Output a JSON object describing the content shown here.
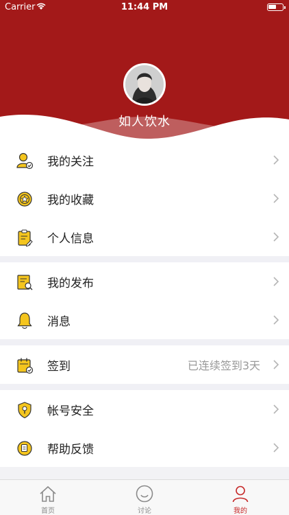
{
  "status_bar": {
    "carrier": "Carrier",
    "time": "11:44 PM"
  },
  "profile": {
    "username": "如人饮水"
  },
  "menu_groups": [
    {
      "items": [
        {
          "label": "我的关注",
          "icon": "follow-user-icon"
        },
        {
          "label": "我的收藏",
          "icon": "favorite-star-icon"
        },
        {
          "label": "个人信息",
          "icon": "profile-clipboard-icon"
        }
      ]
    },
    {
      "items": [
        {
          "label": "我的发布",
          "icon": "publish-doc-icon"
        },
        {
          "label": "消息",
          "icon": "bell-icon"
        }
      ]
    },
    {
      "items": [
        {
          "label": "签到",
          "icon": "checkin-calendar-icon",
          "extra": "已连续签到3天"
        }
      ]
    },
    {
      "items": [
        {
          "label": "帐号安全",
          "icon": "security-shield-icon"
        },
        {
          "label": "帮助反馈",
          "icon": "help-feedback-icon"
        }
      ]
    }
  ],
  "tabbar": {
    "tabs": [
      {
        "label": "首页",
        "icon": "home-icon",
        "active": false
      },
      {
        "label": "讨论",
        "icon": "smile-discussion-icon",
        "active": false
      },
      {
        "label": "我的",
        "icon": "user-profile-icon",
        "active": true
      }
    ]
  },
  "colors": {
    "brand_red": "#a31919",
    "icon_yellow": "#f4c51e",
    "active_tab": "#c62828"
  }
}
